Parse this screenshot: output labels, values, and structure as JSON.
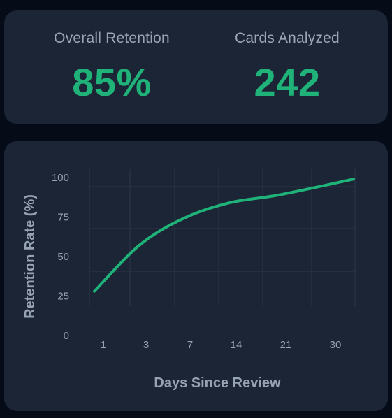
{
  "stats": {
    "retention_label": "Overall Retention",
    "retention_value": "85%",
    "cards_label": "Cards Analyzed",
    "cards_value": "242"
  },
  "colors": {
    "accent": "#1fb37a",
    "card_bg": "#1b2535",
    "page_bg": "#050b17",
    "grid": "#2c3748",
    "text_muted": "#9aa6b8"
  },
  "chart_data": {
    "type": "line",
    "title": "",
    "xlabel": "Days Since Review",
    "ylabel": "Retention Rate (%)",
    "categories": [
      "1",
      "3",
      "7",
      "14",
      "21",
      "30"
    ],
    "yticks": [
      0,
      25,
      50,
      75,
      100
    ],
    "ylim": [
      0,
      100
    ],
    "grid": true,
    "series": [
      {
        "values": [
          28,
          57,
          74,
          84,
          89,
          99
        ]
      }
    ]
  }
}
